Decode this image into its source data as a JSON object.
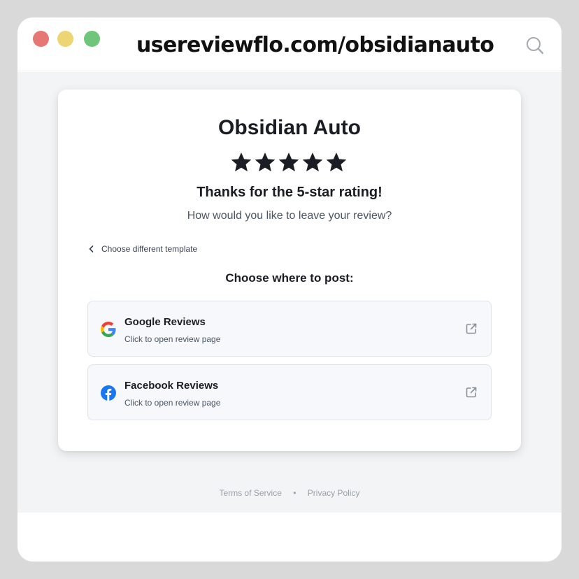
{
  "browser": {
    "url": "usereviewflo.com/obsidianauto"
  },
  "card": {
    "business_name": "Obsidian Auto",
    "rating": {
      "value": 5,
      "max": 5
    },
    "thanks_heading": "Thanks for the 5-star rating!",
    "prompt": "How would you like to leave your review?",
    "back_link_label": "Choose different template",
    "post_heading": "Choose where to post:",
    "options": [
      {
        "title": "Google Reviews",
        "subtitle": "Click to open review page",
        "icon": "google-icon"
      },
      {
        "title": "Facebook Reviews",
        "subtitle": "Click to open review page",
        "icon": "facebook-icon"
      }
    ]
  },
  "footer": {
    "terms_label": "Terms of Service",
    "separator": "•",
    "privacy_label": "Privacy Policy"
  },
  "colors": {
    "facebook_blue": "#1877f2",
    "star_color": "#1a1d23"
  }
}
